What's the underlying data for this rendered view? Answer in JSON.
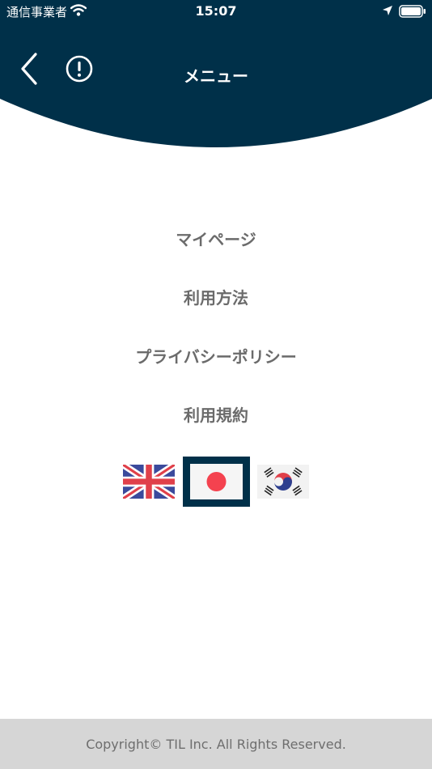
{
  "status_bar": {
    "carrier": "通信事業者",
    "time": "15:07",
    "wifi_icon": "wifi-icon",
    "location_icon": "location-arrow-icon",
    "battery_icon": "battery-icon"
  },
  "header": {
    "title": "メニュー",
    "back_icon": "chevron-left-icon",
    "info_icon": "exclamation-circle-icon",
    "background_color": "#003049"
  },
  "menu": {
    "items": [
      {
        "label": "マイページ"
      },
      {
        "label": "利用方法"
      },
      {
        "label": "プライバシーポリシー"
      },
      {
        "label": "利用規約"
      }
    ]
  },
  "languages": {
    "options": [
      "english-flag",
      "japanese-flag",
      "korean-flag"
    ],
    "selected": "japanese-flag",
    "selected_border_color": "#003049"
  },
  "footer": {
    "copyright": "Copyright© TIL Inc. All Rights Reserved."
  }
}
